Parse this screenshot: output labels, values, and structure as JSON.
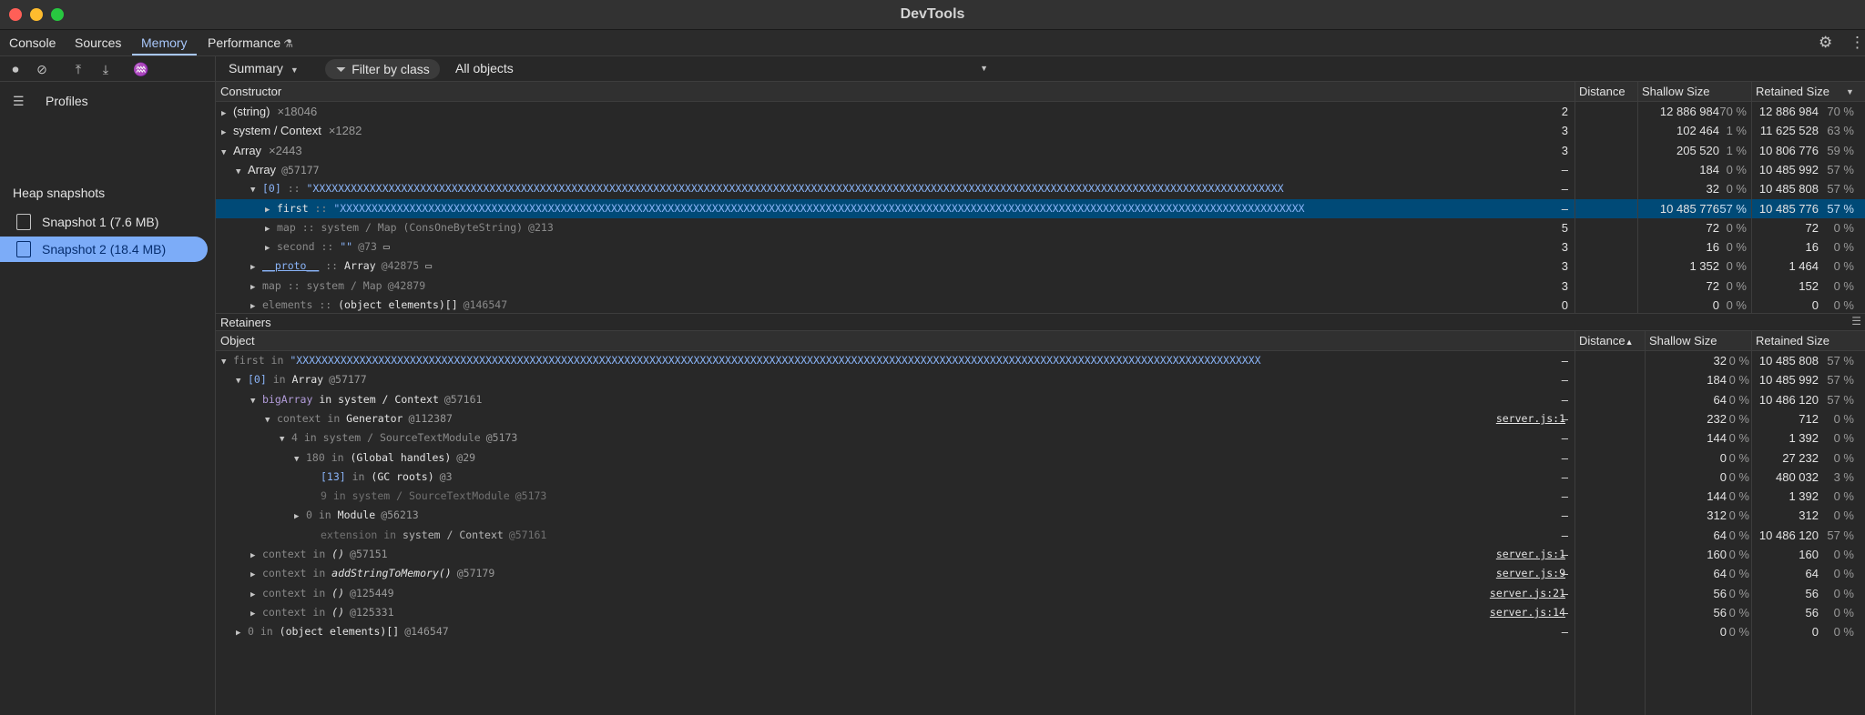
{
  "window": {
    "title": "DevTools"
  },
  "tabs": [
    {
      "label": "Console",
      "active": false
    },
    {
      "label": "Sources",
      "active": false
    },
    {
      "label": "Memory",
      "active": true
    },
    {
      "label": "Performance",
      "active": false
    }
  ],
  "sidebar": {
    "profiles_label": "Profiles",
    "heap_snapshots_title": "Heap snapshots",
    "snapshots": [
      {
        "label": "Snapshot 1 (7.6 MB)",
        "selected": false
      },
      {
        "label": "Snapshot 2 (18.4 MB)",
        "selected": true
      }
    ]
  },
  "toolbar": {
    "view_select": "Summary",
    "filter_label": "Filter by class",
    "objects_select": "All objects"
  },
  "constructors": {
    "headers": {
      "name": "Constructor",
      "distance": "Distance",
      "shallow": "Shallow Size",
      "retained": "Retained Size"
    },
    "rows": [
      {
        "name": "(string)",
        "count": "×18046",
        "distance": "2",
        "shallow": "12 886 984",
        "shallow_pct": "70 %",
        "retained": "12 886 984",
        "retained_pct": "70 %"
      },
      {
        "name": "system / Context",
        "count": "×1282",
        "distance": "3",
        "shallow": "102 464",
        "shallow_pct": "1 %",
        "retained": "11 625 528",
        "retained_pct": "63 %"
      },
      {
        "name": "Array",
        "count": "×2443",
        "distance": "3",
        "shallow": "205 520",
        "shallow_pct": "1 %",
        "retained": "10 806 776",
        "retained_pct": "59 %"
      },
      {
        "name": "Array",
        "id": "@57177",
        "distance": "–",
        "shallow": "184",
        "shallow_pct": "0 %",
        "retained": "10 485 992",
        "retained_pct": "57 %"
      },
      {
        "key": "[0]",
        "sep": " :: ",
        "value": "\"XXXXXXXXXXXXXXXXXXXXXXXXXXXXXXXXXXXXXXXXXXXXXXXXXXXXXXXXXXXXXXXXXXXXXXXXXXXXXXXXXXXXXXXXXXXXXXXXXXXXXXXXXXXXXXXXXXXXXXXXXXXXXXXXXXXXXXXXXXXXXXXXXXXXXXXXXX",
        "distance": "–",
        "shallow": "32",
        "shallow_pct": "0 %",
        "retained": "10 485 808",
        "retained_pct": "57 %"
      },
      {
        "key": "first",
        "sep": " :: ",
        "value": "\"XXXXXXXXXXXXXXXXXXXXXXXXXXXXXXXXXXXXXXXXXXXXXXXXXXXXXXXXXXXXXXXXXXXXXXXXXXXXXXXXXXXXXXXXXXXXXXXXXXXXXXXXXXXXXXXXXXXXXXXXXXXXXXXXXXXXXXXXXXXXXXXXXXXXXXXXX",
        "distance": "–",
        "shallow": "10 485 776",
        "shallow_pct": "57 %",
        "retained": "10 485 776",
        "retained_pct": "57 %"
      },
      {
        "key": "map",
        "sep": " :: ",
        "value": "system / Map (ConsOneByteString)",
        "id": "@213",
        "distance": "5",
        "shallow": "72",
        "shallow_pct": "0 %",
        "retained": "72",
        "retained_pct": "0 %"
      },
      {
        "key": "second",
        "sep": " :: ",
        "value": "\"\"",
        "id": "@73",
        "distance": "3",
        "shallow": "16",
        "shallow_pct": "0 %",
        "retained": "16",
        "retained_pct": "0 %"
      },
      {
        "key": "__proto__",
        "sep": " :: ",
        "value": "Array",
        "id": "@42875",
        "distance": "3",
        "shallow": "1 352",
        "shallow_pct": "0 %",
        "retained": "1 464",
        "retained_pct": "0 %"
      },
      {
        "key": "map",
        "sep": " :: ",
        "value": "system / Map",
        "id": "@42879",
        "distance": "3",
        "shallow": "72",
        "shallow_pct": "0 %",
        "retained": "152",
        "retained_pct": "0 %"
      },
      {
        "key": "elements",
        "sep": " :: ",
        "value": "(object elements)[]",
        "id": "@146547",
        "distance": "0",
        "shallow": "0",
        "shallow_pct": "0 %",
        "retained": "0",
        "retained_pct": "0 %"
      }
    ]
  },
  "retainers": {
    "title": "Retainers",
    "headers": {
      "name": "Object",
      "distance": "Distance",
      "shallow": "Shallow Size",
      "retained": "Retained Size"
    },
    "rows": [
      {
        "key": "first",
        "in": " in ",
        "value": "\"XXXXXXXXXXXXXXXXXXXXXXXXXXXXXXXXXXXXXXXXXXXXXXXXXXXXXXXXXXXXXXXXXXXXXXXXXXXXXXXXXXXXXXXXXXXXXXXXXXXXXXXXXXXXXXXXXXXXXXXXXXXXXXXXXXXXXXXXXXXXXXXXXXXXXXXXX",
        "distance": "–",
        "shallow": "32",
        "shallow_pct": "0 %",
        "retained": "10 485 808",
        "retained_pct": "57 %"
      },
      {
        "key": "[0]",
        "in": " in ",
        "value": "Array",
        "id": "@57177",
        "distance": "–",
        "shallow": "184",
        "shallow_pct": "0 %",
        "retained": "10 485 992",
        "retained_pct": "57 %"
      },
      {
        "key": "bigArray",
        "in": " in ",
        "value": "system / Context",
        "id": "@57161",
        "distance": "–",
        "shallow": "64",
        "shallow_pct": "0 %",
        "retained": "10 486 120",
        "retained_pct": "57 %"
      },
      {
        "key": "context",
        "in": " in ",
        "value": "Generator",
        "id": "@112387",
        "link": "server.js:1",
        "distance": "–",
        "shallow": "232",
        "shallow_pct": "0 %",
        "retained": "712",
        "retained_pct": "0 %"
      },
      {
        "key": "4",
        "in": " in ",
        "value": "system / SourceTextModule",
        "id": "@5173",
        "distance": "–",
        "shallow": "144",
        "shallow_pct": "0 %",
        "retained": "1 392",
        "retained_pct": "0 %"
      },
      {
        "key": "180",
        "in": " in ",
        "value": "(Global handles)",
        "id": "@29",
        "distance": "–",
        "shallow": "0",
        "shallow_pct": "0 %",
        "retained": "27 232",
        "retained_pct": "0 %"
      },
      {
        "key": "[13]",
        "in": " in ",
        "value": "(GC roots)",
        "id": "@3",
        "distance": "–",
        "shallow": "0",
        "shallow_pct": "0 %",
        "retained": "480 032",
        "retained_pct": "3 %"
      },
      {
        "key": "9",
        "in": " in ",
        "value": "system / SourceTextModule",
        "id": "@5173",
        "distance": "–",
        "shallow": "144",
        "shallow_pct": "0 %",
        "retained": "1 392",
        "retained_pct": "0 %"
      },
      {
        "key": "0",
        "in": " in ",
        "value": "Module",
        "id": "@56213",
        "distance": "–",
        "shallow": "312",
        "shallow_pct": "0 %",
        "retained": "312",
        "retained_pct": "0 %"
      },
      {
        "key": "extension",
        "in": " in ",
        "value": "system / Context",
        "id": "@57161",
        "distance": "–",
        "shallow": "64",
        "shallow_pct": "0 %",
        "retained": "10 486 120",
        "retained_pct": "57 %"
      },
      {
        "key": "context",
        "in": " in ",
        "value": "()",
        "id": "@57151",
        "link": "server.js:1",
        "distance": "–",
        "shallow": "160",
        "shallow_pct": "0 %",
        "retained": "160",
        "retained_pct": "0 %"
      },
      {
        "key": "context",
        "in": " in ",
        "value": "addStringToMemory()",
        "id": "@57179",
        "link": "server.js:9",
        "distance": "–",
        "shallow": "64",
        "shallow_pct": "0 %",
        "retained": "64",
        "retained_pct": "0 %"
      },
      {
        "key": "context",
        "in": " in ",
        "value": "()",
        "id": "@125449",
        "link": "server.js:21",
        "distance": "–",
        "shallow": "56",
        "shallow_pct": "0 %",
        "retained": "56",
        "retained_pct": "0 %"
      },
      {
        "key": "context",
        "in": " in ",
        "value": "()",
        "id": "@125331",
        "link": "server.js:14",
        "distance": "–",
        "shallow": "56",
        "shallow_pct": "0 %",
        "retained": "56",
        "retained_pct": "0 %"
      },
      {
        "key": "0",
        "in": " in ",
        "value": "(object elements)[]",
        "id": "@146547",
        "distance": "–",
        "shallow": "0",
        "shallow_pct": "0 %",
        "retained": "0",
        "retained_pct": "0 %"
      }
    ]
  }
}
